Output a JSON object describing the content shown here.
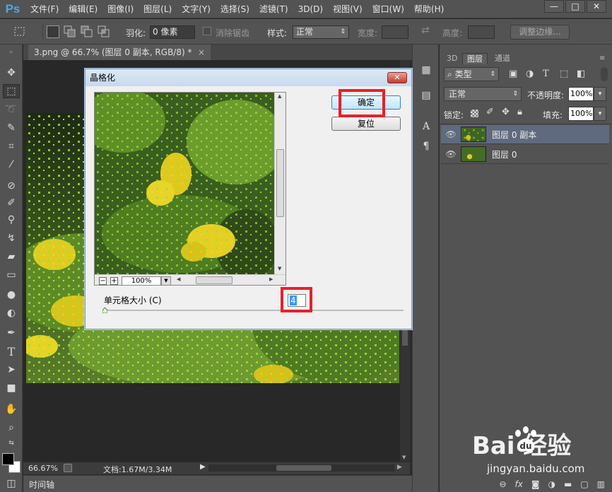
{
  "app": {
    "logo": "Ps",
    "menus": [
      "文件(F)",
      "编辑(E)",
      "图像(I)",
      "图层(L)",
      "文字(Y)",
      "选择(S)",
      "滤镜(T)",
      "3D(D)",
      "视图(V)",
      "窗口(W)",
      "帮助(H)"
    ],
    "window_buttons": [
      "—",
      "□",
      "✕"
    ]
  },
  "options_bar": {
    "feather_label": "羽化:",
    "feather_value": "0 像素",
    "antialias_label": "消除锯齿",
    "style_label": "样式:",
    "style_value": "正常",
    "width_label": "宽度:",
    "height_label": "高度:",
    "refine_edge_button": "调整边缘..."
  },
  "document": {
    "tab_title": "3.png @ 66.7% (图层 0 副本, RGB/8) *",
    "tab_close": "×"
  },
  "status_bar": {
    "zoom": "66.67%",
    "doc_info": "文档:1.67M/3.34M"
  },
  "timeline": {
    "label": "时间轴"
  },
  "dialog": {
    "title": "晶格化",
    "close": "✕",
    "ok_button": "确定",
    "reset_button": "复位",
    "zoom_minus": "−",
    "zoom_plus": "+",
    "zoom_value": "100%",
    "cell_size_label": "单元格大小 (C)",
    "cell_size_value": "4"
  },
  "layers_panel": {
    "tabs": [
      "3D",
      "图层",
      "通道"
    ],
    "filter_kind": "类型",
    "blend_mode": "正常",
    "opacity_label": "不透明度:",
    "opacity_value": "100%",
    "lock_label": "锁定:",
    "fill_label": "填充:",
    "fill_value": "100%",
    "layers": [
      {
        "name": "图层 0 副本",
        "selected": true
      },
      {
        "name": "图层 0",
        "selected": false
      }
    ],
    "footer_icons": [
      "link-icon",
      "fx-icon",
      "mask-icon",
      "adjustment-icon",
      "group-icon",
      "new-layer-icon",
      "trash-icon"
    ],
    "footer_fx": "fx"
  },
  "watermark": {
    "logo": "Bai  经验",
    "url": "jingyan.baidu.com"
  },
  "colors": {
    "highlight_red": "#e8202a",
    "selected_layer": "#606a7e",
    "ps_blue": "#4fa6e8"
  }
}
